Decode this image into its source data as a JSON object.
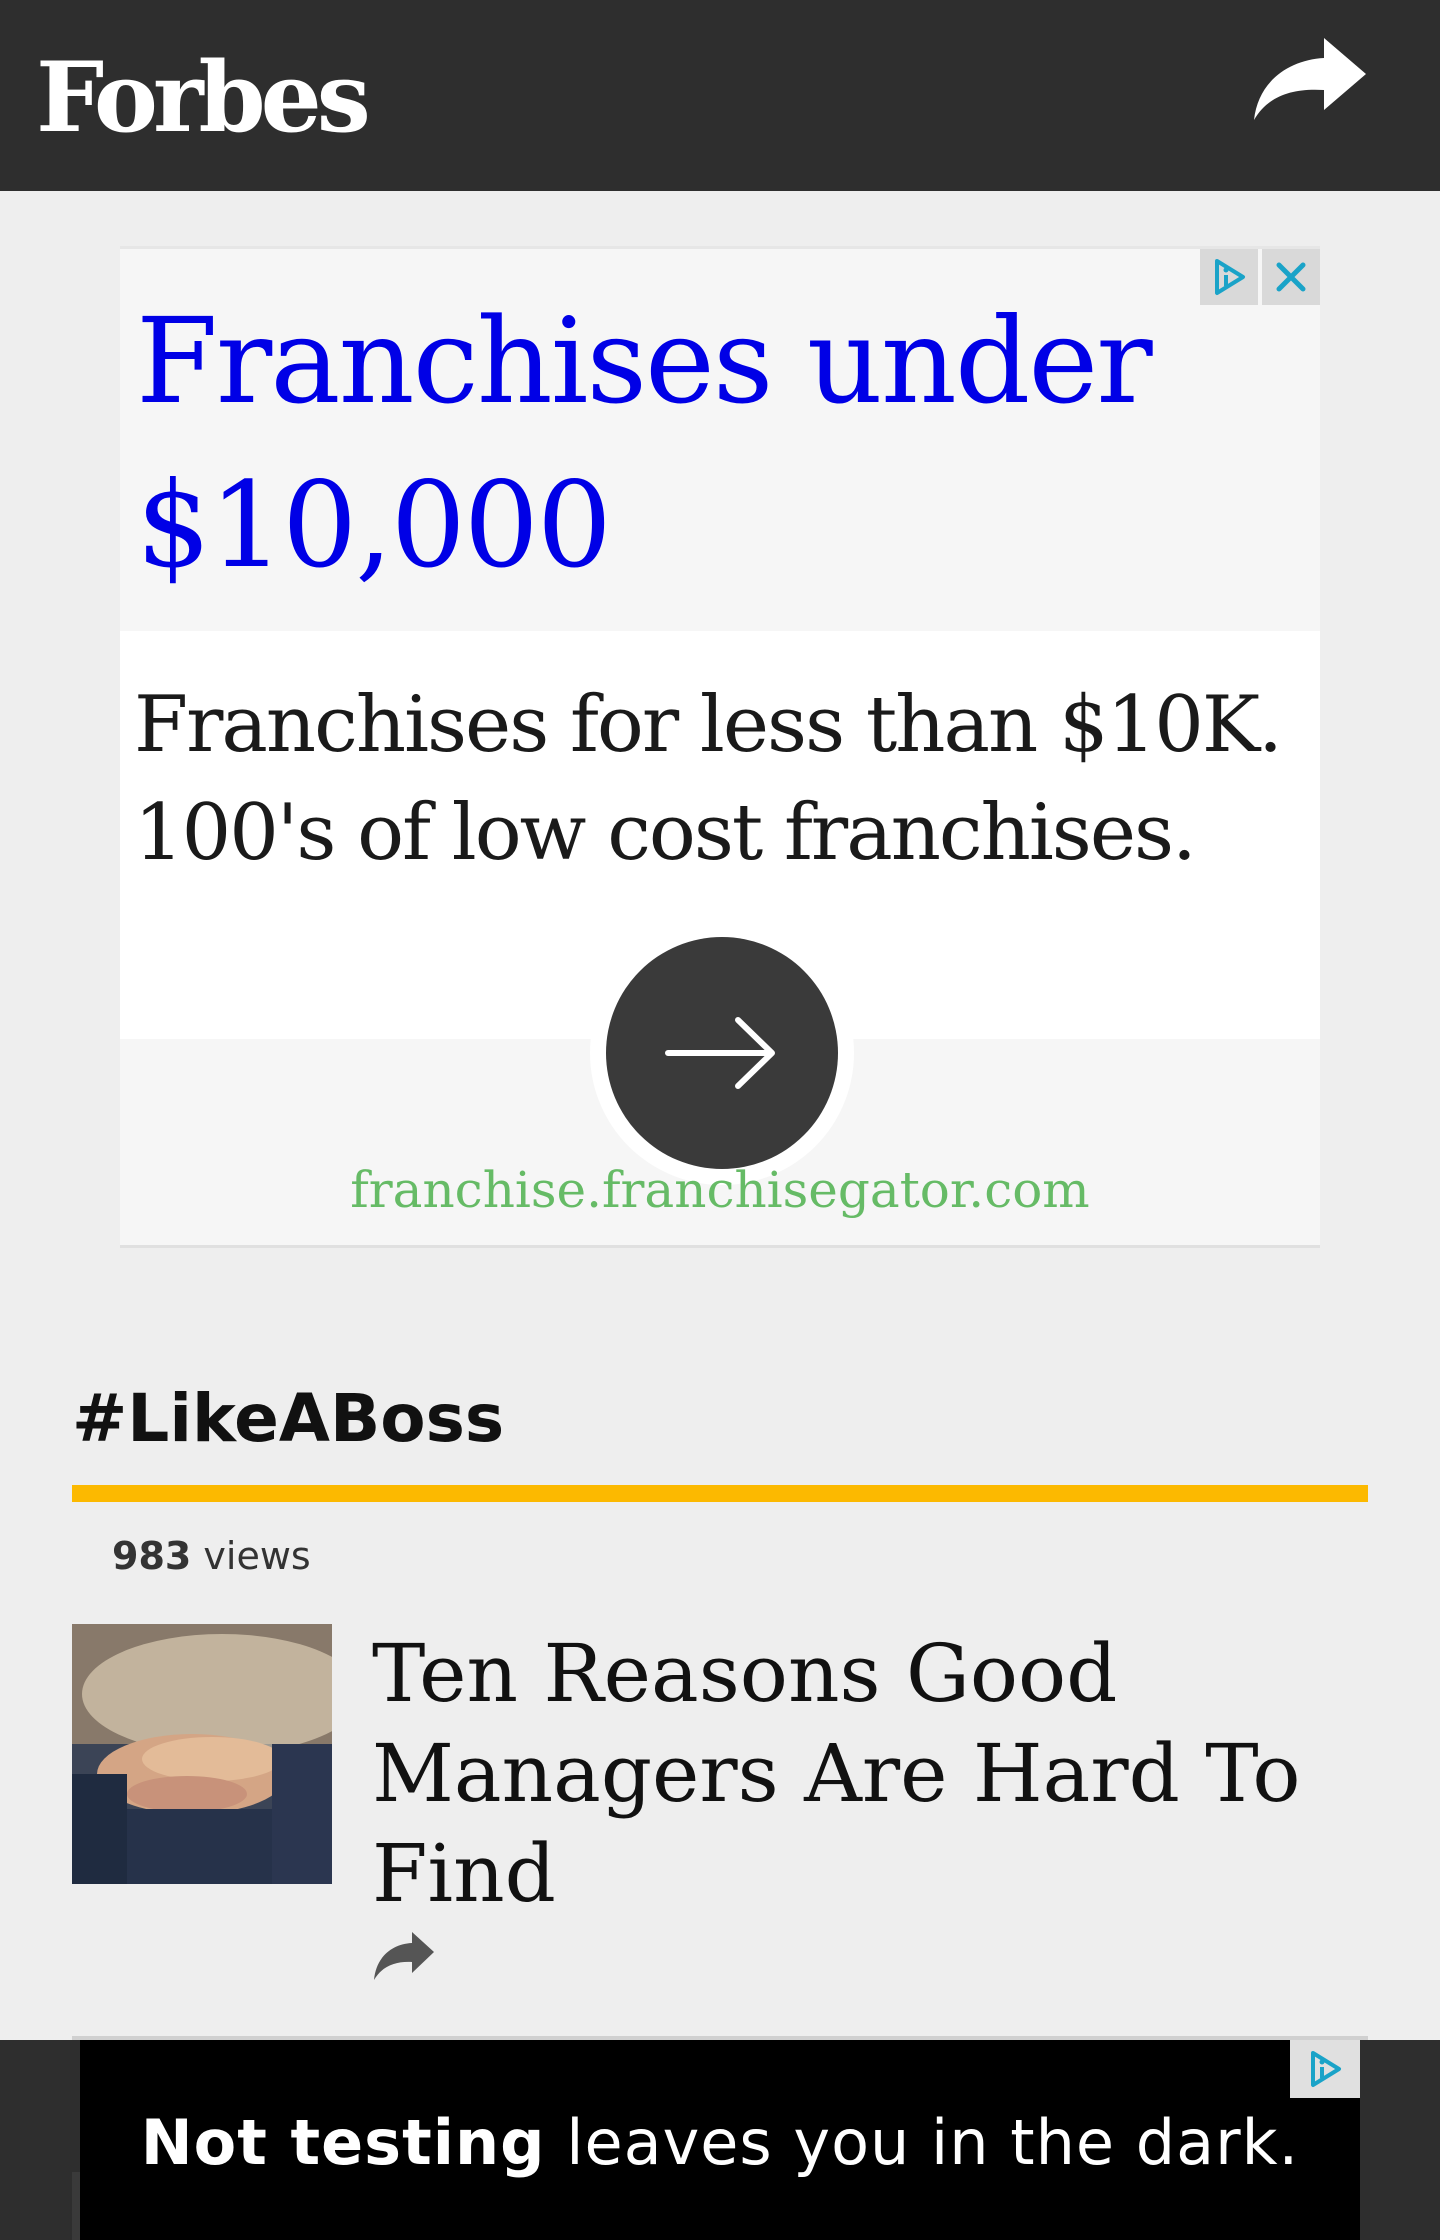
{
  "header": {
    "logo": "Forbes",
    "share_icon": "share-arrow-icon"
  },
  "ad": {
    "headline": "Franchises under $10,000",
    "description": "Franchises for less than $10K. 100's of low cost franchises.",
    "domain": "franchise.franchisegator.com",
    "cta_icon": "arrow-right-icon",
    "adchoices_icon": "adchoices-icon",
    "close_icon": "close-icon",
    "colors": {
      "headline": "#0000e6",
      "domain": "#66bb66",
      "badge_icon": "#1aa3c8"
    }
  },
  "section": {
    "title": "#LikeABoss",
    "accent_color": "#fcb900"
  },
  "story": {
    "views_count": "983",
    "views_label": "views",
    "title": "Ten Reasons Good Managers Are Hard To Find",
    "share_icon": "share-arrow-icon"
  },
  "banner": {
    "bold_text": "Not testing",
    "rest_text": "leaves you in the dark.",
    "adchoices_icon": "adchoices-icon"
  }
}
